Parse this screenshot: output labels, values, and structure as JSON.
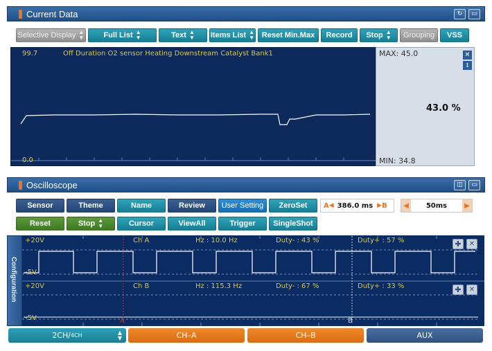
{
  "current_data": {
    "title": "Current Data",
    "toolbar": {
      "selective_display": "Selective Display",
      "full_list": "Full List",
      "text": "Text",
      "items_list": "Items List",
      "reset_min_max": "Reset Min.Max",
      "record": "Record",
      "stop": "Stop",
      "grouping": "Grouping",
      "vss": "VSS"
    },
    "graph": {
      "top_value": "99.7",
      "bottom_value": "0.0",
      "label": "Off Duration O2 sensor Heating Downstream Catalyst Bank1"
    },
    "side": {
      "max": "MAX: 45.0",
      "min": "MIN: 34.8",
      "current": "43.0 %"
    }
  },
  "oscilloscope": {
    "title": "Oscilloscope",
    "toolbar_row1": {
      "sensor": "Sensor",
      "theme": "Theme",
      "name": "Name",
      "review": "Review",
      "user_setting": "User Setting",
      "zeroset": "ZeroSet"
    },
    "toolbar_row2": {
      "reset": "Reset",
      "stop": "Stop",
      "cursor": "Cursor",
      "viewall": "ViewAll",
      "trigger": "Trigger",
      "singleshot": "SingleShot"
    },
    "cursor_time": "386.0 ms",
    "cursor_a_label": "A",
    "cursor_b_label": "B",
    "time_div": "50ms",
    "config_label": "Configuration",
    "channel_a": {
      "top": "+20V",
      "bottom": "-5V",
      "name": "Ch A",
      "hz": "Hz : 10.0 Hz",
      "duty_minus": "Duty- : 43 %",
      "duty_plus": "Duty+ : 57 %"
    },
    "channel_b": {
      "top": "+20V",
      "bottom": "-5V",
      "name": "Ch B",
      "hz": "Hz : 115.3 Hz",
      "duty_minus": "Duty- : 67 %",
      "duty_plus": "Duty+ : 33 %"
    },
    "cursor_marker_a": "A",
    "cursor_marker_b": "B"
  },
  "bottom_tabs": {
    "ch_mode_main": "2CH",
    "ch_mode_sep": "/",
    "ch_mode_alt": "4CH",
    "ch_a": "CH–A",
    "ch_b": "CH–B",
    "aux": "AUX"
  },
  "colors": {
    "teal_button": "#157f95",
    "graph_bg": "#0e2a5c",
    "trace": "#ffffff",
    "label_yellow": "#d9c83a",
    "orange_tab": "#d96a10"
  }
}
